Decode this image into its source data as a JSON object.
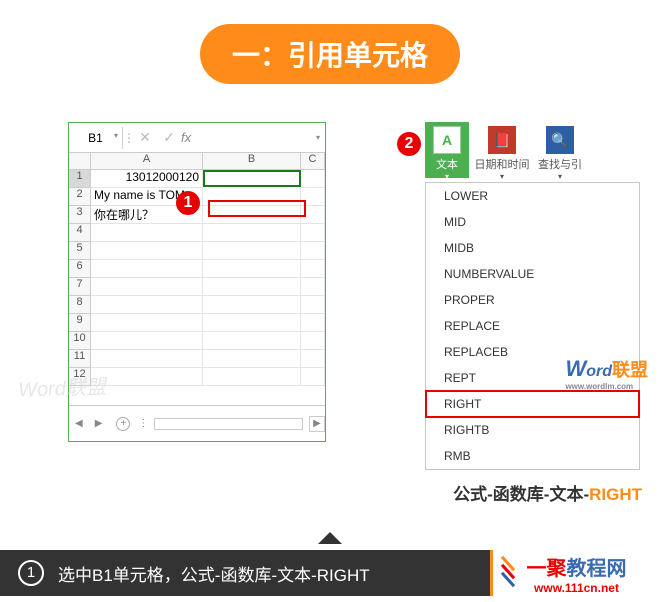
{
  "title": "一：引用单元格",
  "excel": {
    "name_box": "B1",
    "rows": [
      {
        "n": "1",
        "a": "13012000120",
        "b": "",
        "c": ""
      },
      {
        "n": "2",
        "a": "My name is TOM.",
        "b": "",
        "c": ""
      },
      {
        "n": "3",
        "a": "你在哪儿？",
        "b": "",
        "c": ""
      },
      {
        "n": "4",
        "a": "",
        "b": "",
        "c": ""
      },
      {
        "n": "5",
        "a": "",
        "b": "",
        "c": ""
      },
      {
        "n": "6",
        "a": "",
        "b": "",
        "c": ""
      },
      {
        "n": "7",
        "a": "",
        "b": "",
        "c": ""
      },
      {
        "n": "8",
        "a": "",
        "b": "",
        "c": ""
      },
      {
        "n": "9",
        "a": "",
        "b": "",
        "c": ""
      },
      {
        "n": "10",
        "a": "",
        "b": "",
        "c": ""
      },
      {
        "n": "11",
        "a": "",
        "b": "",
        "c": ""
      },
      {
        "n": "12",
        "a": "",
        "b": "",
        "c": ""
      }
    ],
    "cols": {
      "a": "A",
      "b": "B",
      "c": "C"
    }
  },
  "ribbon": {
    "groups": {
      "text": "文本",
      "date": "日期和时间",
      "find": "查找与引"
    },
    "icons": {
      "text": "A",
      "date": "📕",
      "find": "🔍"
    },
    "menu": [
      "LOWER",
      "MID",
      "MIDB",
      "NUMBERVALUE",
      "PROPER",
      "REPLACE",
      "REPLACEB",
      "REPT",
      "RIGHT",
      "RIGHTB",
      "RMB"
    ],
    "highlight_index": 8
  },
  "markers": {
    "m1": "1",
    "m2": "2"
  },
  "breadcrumb": {
    "prefix": "公式-函数库-文本-",
    "fn": "RIGHT"
  },
  "watermarks": {
    "left": "Word联盟",
    "right_brand_w": "W",
    "right_brand_rest": "ord",
    "right_union": "联盟",
    "right_url": "www.wordlm.com"
  },
  "footer": {
    "num": "1",
    "text": "选中B1单元格，公式-函数库-文本-RIGHT",
    "logo_main": "一聚",
    "logo_rest": "教程网",
    "logo_url": "www.111cn.net"
  }
}
